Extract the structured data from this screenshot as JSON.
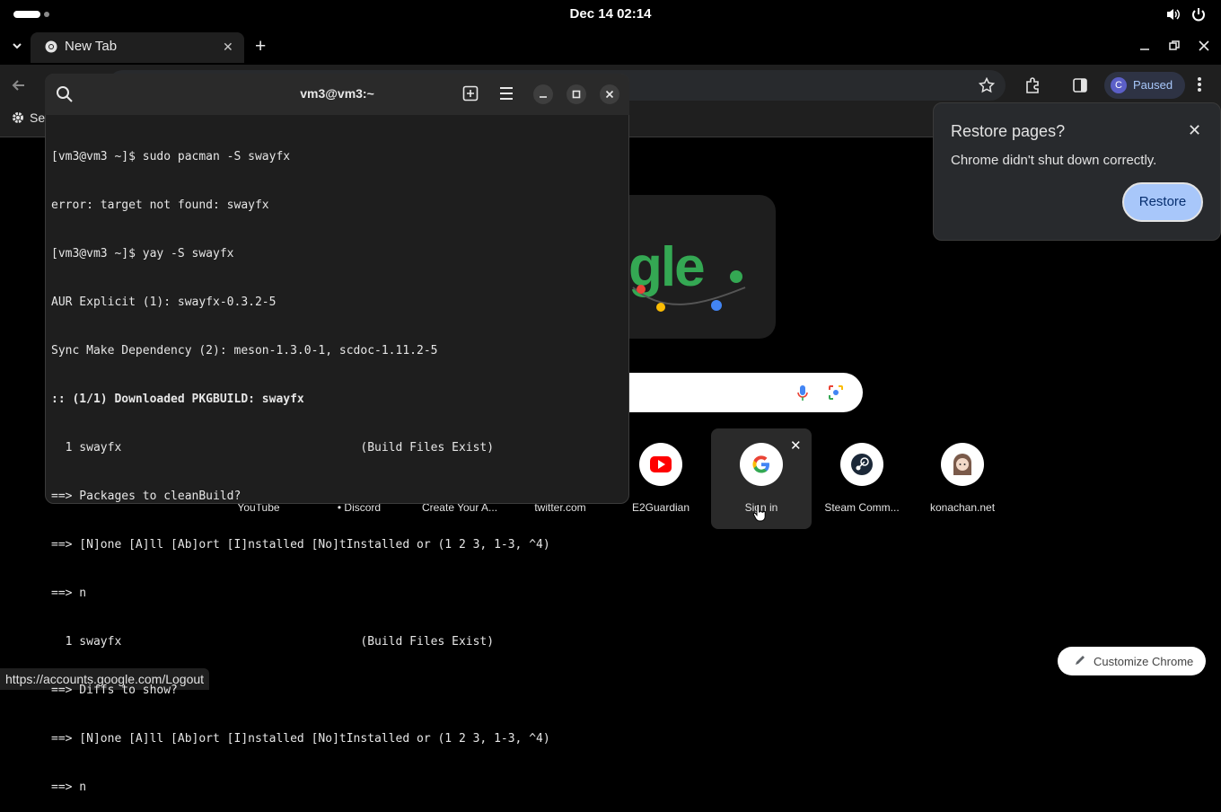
{
  "system": {
    "clock": "Dec 14  02:14"
  },
  "browser": {
    "tab_title": "New Tab",
    "profile_initial": "C",
    "profile_status": "Paused",
    "bookmark_label": "Se",
    "status_url": "https://accounts.google.com/Logout",
    "customize_label": "Customize Chrome"
  },
  "ntp": {
    "doodle_text": "gle",
    "shortcuts": [
      {
        "label": "YouTube"
      },
      {
        "label": "• Discord"
      },
      {
        "label": "Create Your A..."
      },
      {
        "label": "twitter.com"
      },
      {
        "label": "E2Guardian"
      },
      {
        "label": "Sign in"
      },
      {
        "label": "Steam Comm..."
      },
      {
        "label": "konachan.net"
      }
    ]
  },
  "restore_popup": {
    "title": "Restore pages?",
    "message": "Chrome didn't shut down correctly.",
    "button": "Restore"
  },
  "terminal": {
    "title": "vm3@vm3:~",
    "lines": [
      {
        "text": "[vm3@vm3 ~]$ sudo pacman -S swayfx",
        "bold": false
      },
      {
        "text": "error: target not found: swayfx",
        "bold": false
      },
      {
        "text": "[vm3@vm3 ~]$ yay -S swayfx",
        "bold": false
      },
      {
        "text": "AUR Explicit (1): swayfx-0.3.2-5",
        "bold": false
      },
      {
        "text": "Sync Make Dependency (2): meson-1.3.0-1, scdoc-1.11.2-5",
        "bold": false
      },
      {
        "text": ":: (1/1) Downloaded PKGBUILD: swayfx",
        "bold": true
      },
      {
        "text": "  1 swayfx                                  (Build Files Exist)",
        "bold": false
      },
      {
        "text": "==> Packages to cleanBuild?",
        "bold": false
      },
      {
        "text": "==> [N]one [A]ll [Ab]ort [I]nstalled [No]tInstalled or (1 2 3, 1-3, ^4)",
        "bold": false
      },
      {
        "text": "==> n",
        "bold": false
      },
      {
        "text": "  1 swayfx                                  (Build Files Exist)",
        "bold": false
      },
      {
        "text": "==> Diffs to show?",
        "bold": false
      },
      {
        "text": "==> [N]one [A]ll [Ab]ort [I]nstalled [No]tInstalled or (1 2 3, 1-3, ^4)",
        "bold": false
      },
      {
        "text": "==> n",
        "bold": false
      }
    ]
  },
  "colors": {
    "accent": "#a8c7fa",
    "terminal_bg": "#1e1e1e",
    "chrome_bg": "#1f1f1f"
  }
}
